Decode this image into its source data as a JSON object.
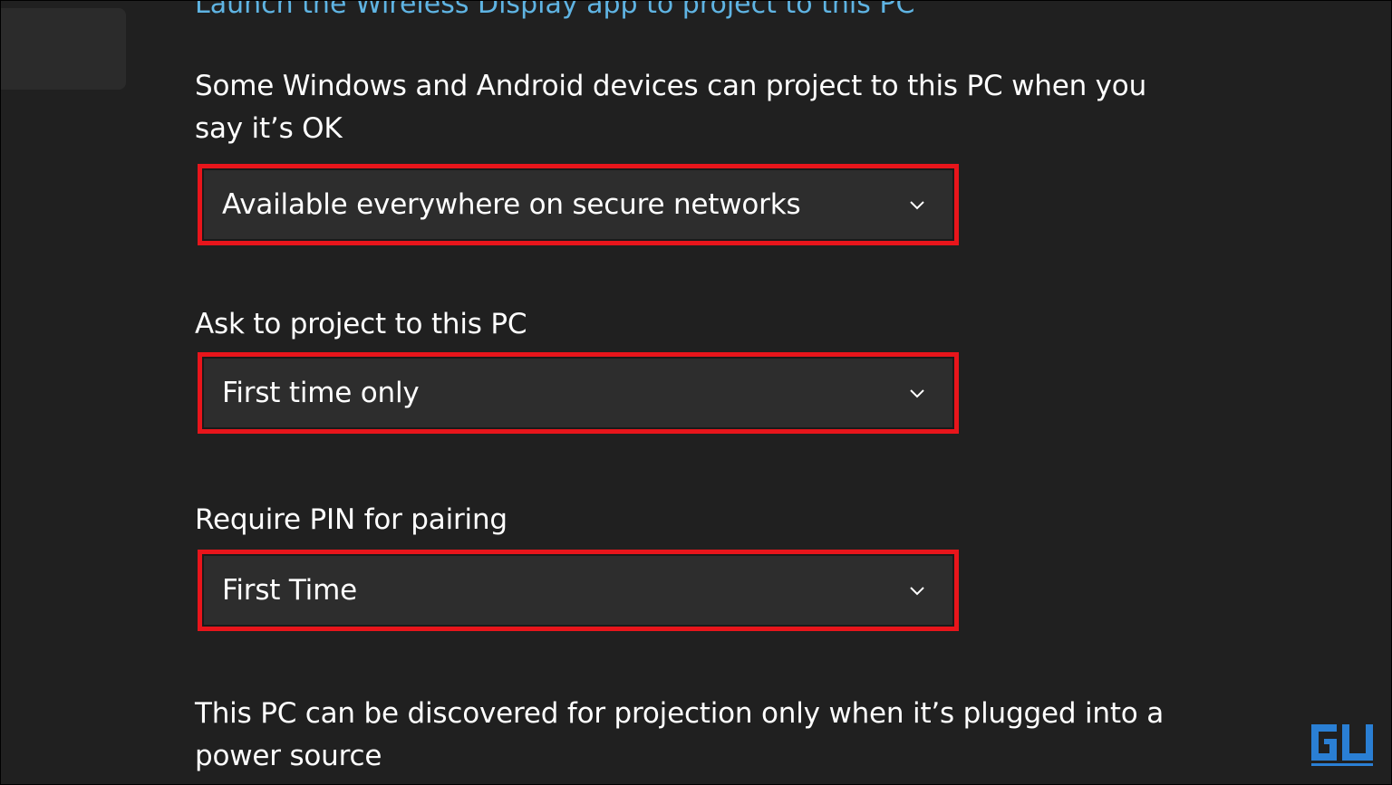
{
  "top_link": "Launch the Wireless Display app to project to this PC",
  "availability": {
    "description": "Some Windows and Android devices can project to this PC when you say it’s OK",
    "selected": "Available everywhere on secure networks"
  },
  "ask_to_project": {
    "label": "Ask to project to this PC",
    "selected": "First time only"
  },
  "require_pin": {
    "label": "Require PIN for pairing",
    "selected": "First Time"
  },
  "power_note": "This PC can be discovered for projection only when it’s plugged into a power source",
  "colors": {
    "background": "#202020",
    "dropdown": "#2d2d2d",
    "highlight": "#e8151b",
    "link": "#5fb4e3"
  },
  "icons": {
    "chevron": "chevron-down-icon",
    "watermark": "gadgets-to-use-logo"
  }
}
